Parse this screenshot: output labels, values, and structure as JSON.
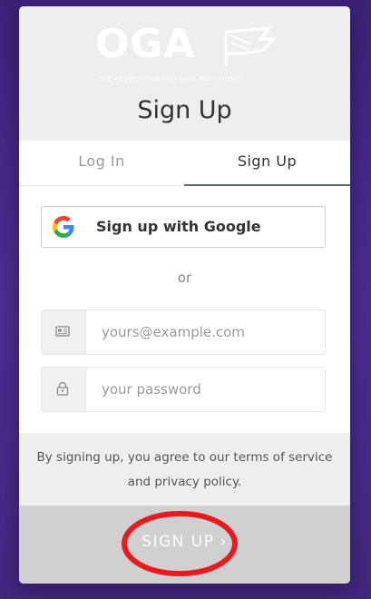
{
  "logo": {
    "text": "OGA",
    "tagline": "THE ASSOCIATION FOR GAFF RIG SAILING"
  },
  "title": "Sign Up",
  "tabs": {
    "login": "Log In",
    "signup": "Sign Up",
    "active": "signup"
  },
  "social": {
    "google_label": "Sign up with Google"
  },
  "divider": "or",
  "form": {
    "email_placeholder": "yours@example.com",
    "email_value": "",
    "password_placeholder": "your password",
    "password_value": ""
  },
  "terms": "By signing up, you agree to our terms of service and privacy policy.",
  "submit": {
    "label": "SIGN UP",
    "chevron": "›"
  },
  "colors": {
    "backdrop": "#4a2a8a",
    "header_bg": "#eeeeee",
    "submit_bg": "#d0d0d0",
    "annotation": "#e8191f",
    "google_blue": "#4285F4",
    "google_red": "#EA4335",
    "google_yellow": "#FBBC05",
    "google_green": "#34A853"
  },
  "icons": {
    "logo": "oga-logo-icon",
    "google": "google-icon",
    "email": "envelope-icon",
    "password": "lock-icon",
    "chevron": "chevron-right-icon"
  }
}
